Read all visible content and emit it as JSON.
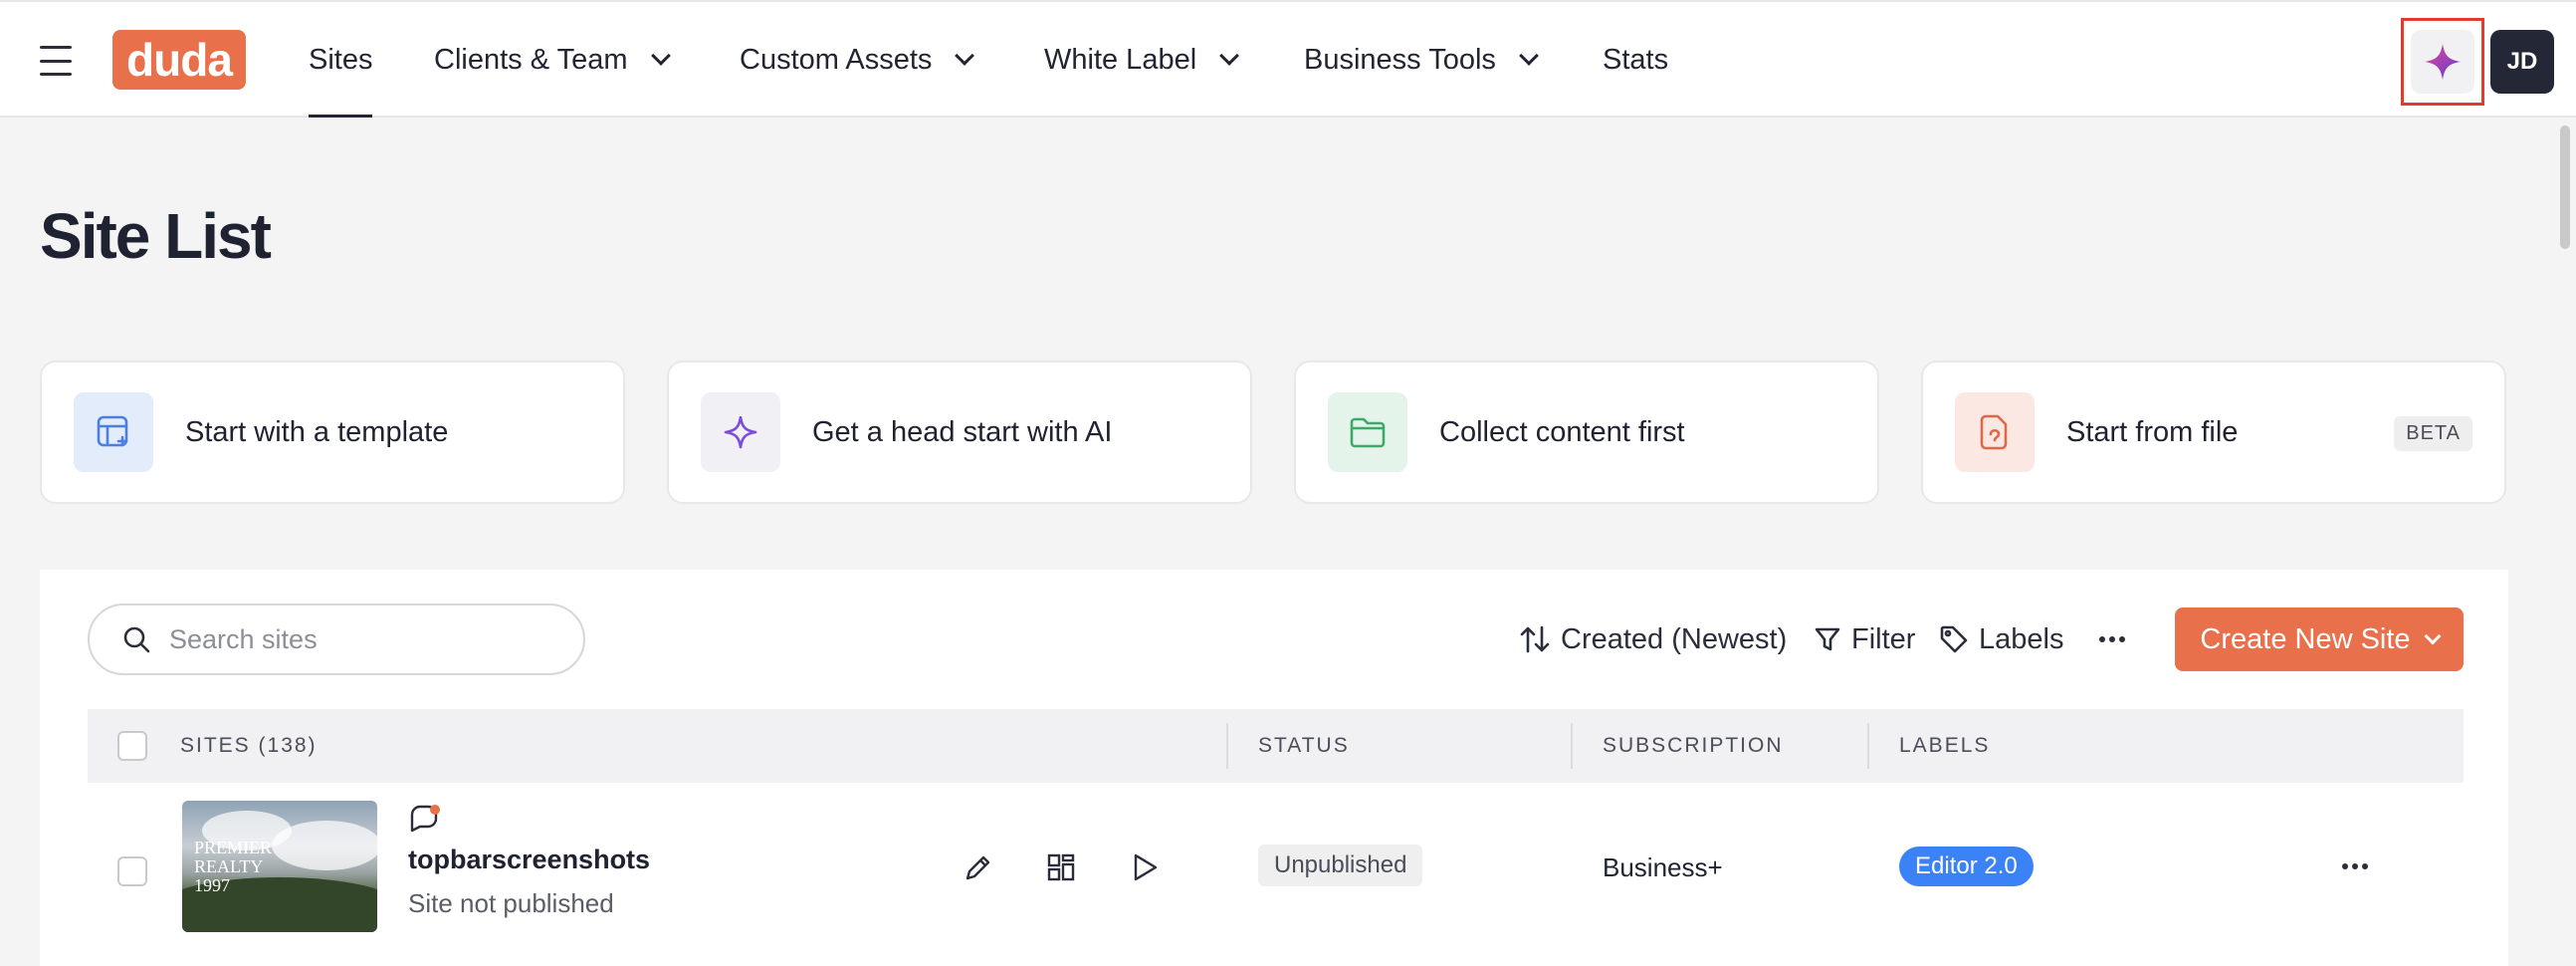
{
  "nav": {
    "logo": "duda",
    "items": [
      {
        "label": "Sites",
        "active": true
      },
      {
        "label": "Clients & Team",
        "dropdown": true
      },
      {
        "label": "Custom Assets",
        "dropdown": true
      },
      {
        "label": "White Label",
        "dropdown": true
      },
      {
        "label": "Business Tools",
        "dropdown": true
      },
      {
        "label": "Stats"
      }
    ],
    "avatar_initials": "JD"
  },
  "page": {
    "title": "Site List"
  },
  "start_cards": [
    {
      "label": "Start with a template",
      "icon": "template-icon"
    },
    {
      "label": "Get a head start with AI",
      "icon": "sparkle-icon"
    },
    {
      "label": "Collect content first",
      "icon": "folder-icon"
    },
    {
      "label": "Start from file",
      "icon": "file-icon",
      "badge": "BETA"
    }
  ],
  "toolbar": {
    "search_placeholder": "Search sites",
    "sort_label": "Created (Newest)",
    "filter_label": "Filter",
    "labels_label": "Labels",
    "create_label": "Create New Site"
  },
  "table": {
    "headers": {
      "sites": "SITES (138)",
      "status": "STATUS",
      "subscription": "SUBSCRIPTION",
      "labels": "LABELS"
    },
    "rows": [
      {
        "thumb_text": "PREMIER REALTY 1997",
        "name": "topbarscreenshots",
        "subtitle": "Site not published",
        "status": "Unpublished",
        "subscription": "Business+",
        "label": "Editor 2.0"
      }
    ]
  },
  "colors": {
    "brand": "#e8704a",
    "label_blue": "#3b82f6",
    "ai_purple": "#7c4ddb",
    "highlight_red": "#e23b2e"
  }
}
